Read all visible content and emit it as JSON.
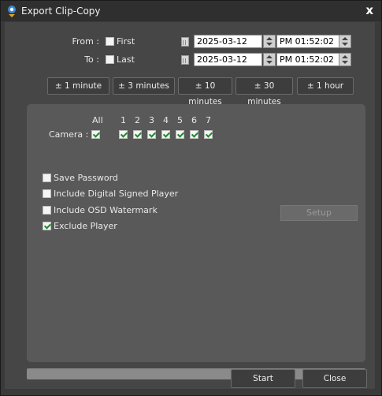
{
  "window": {
    "title": "Export Clip-Copy",
    "close_glyph": "x"
  },
  "range": {
    "from_label": "From :",
    "to_label": "To :",
    "first_label": "First",
    "last_label": "Last",
    "first_checked": false,
    "last_checked": false,
    "from_date": "2025-03-12",
    "from_time": "PM 01:52:02",
    "to_date": "2025-03-12",
    "to_time": "PM 01:52:02"
  },
  "quick_buttons": [
    "± 1 minute",
    "± 3 minutes",
    "± 10 minutes",
    "± 30 minutes",
    "± 1 hour"
  ],
  "cameras": {
    "label": "Camera :",
    "all_label": "All",
    "all_checked": true,
    "items": [
      {
        "num": "1",
        "checked": true
      },
      {
        "num": "2",
        "checked": true
      },
      {
        "num": "3",
        "checked": true
      },
      {
        "num": "4",
        "checked": true
      },
      {
        "num": "5",
        "checked": true
      },
      {
        "num": "6",
        "checked": true
      },
      {
        "num": "7",
        "checked": true
      }
    ]
  },
  "options": [
    {
      "label": "Save Password",
      "checked": false
    },
    {
      "label": "Include Digital Signed Player",
      "checked": false
    },
    {
      "label": "Include OSD Watermark",
      "checked": false
    },
    {
      "label": "Exclude Player",
      "checked": true
    }
  ],
  "setup_label": "Setup",
  "progress": 0,
  "footer": {
    "start_label": "Start",
    "close_label": "Close"
  },
  "icons": {
    "title": "camera-pin-icon",
    "calendar": "calendar-icon",
    "spinner": "spinner-updown-icon"
  }
}
